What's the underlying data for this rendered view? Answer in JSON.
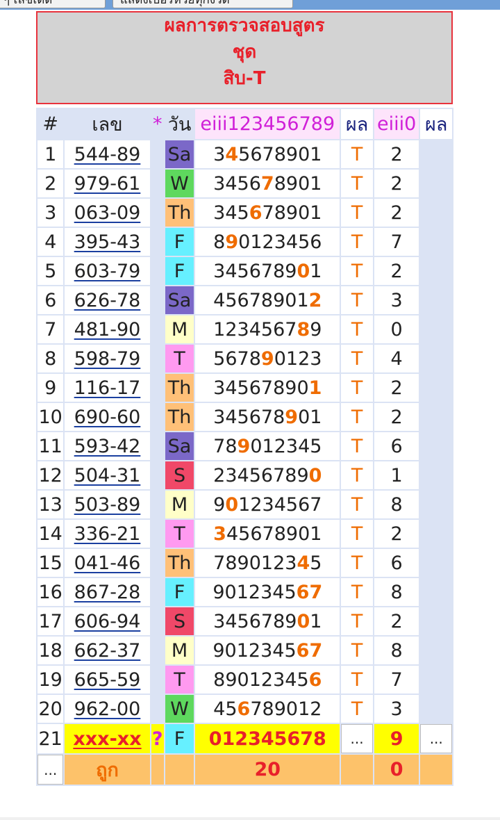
{
  "top_buttons": [
    "ๆ เลขเด็ด",
    "แสดงเบอร์หวยทุกงวด"
  ],
  "header": {
    "line1": "ผลการตรวจสอบสูตร",
    "line2": "ชุด",
    "line3": "สิบ-T"
  },
  "columns": {
    "index": "#",
    "number": "เลข",
    "star": "*",
    "day": "วัน",
    "digits": "eiii123456789",
    "result1": "ผล",
    "zero": "eiii0",
    "result2": "ผล"
  },
  "day_colors": {
    "Sa": "#7b68c8",
    "W": "#5ed85e",
    "Th": "#ffc078",
    "F": "#66f0ff",
    "M": "#ffffc8",
    "T": "#ff9af0",
    "S": "#f04868"
  },
  "rows": [
    {
      "no": "1",
      "num": "544-89",
      "day": "Sa",
      "seq": "345678901",
      "hi": 1,
      "res": "T",
      "z": "2"
    },
    {
      "no": "2",
      "num": "979-61",
      "day": "W",
      "seq": "3456789 01",
      "hi": 4,
      "res": "T",
      "z": "2"
    },
    {
      "no": "3",
      "num": "063-09",
      "day": "Th",
      "seq": "345678901",
      "hi": 3,
      "res": "T",
      "z": "2"
    },
    {
      "no": "4",
      "num": "395-43",
      "day": "F",
      "seq": "890123456",
      "hi": 1,
      "res": "T",
      "z": "7"
    },
    {
      "no": "5",
      "num": "603-79",
      "day": "F",
      "seq": "345678901",
      "hi": 7,
      "res": "T",
      "z": "2"
    },
    {
      "no": "6",
      "num": "626-78",
      "day": "Sa",
      "seq": "456789012",
      "hi": 8,
      "res": "T",
      "z": "3"
    },
    {
      "no": "7",
      "num": "481-90",
      "day": "M",
      "seq": "123456789",
      "hi": 7,
      "res": "T",
      "z": "0"
    },
    {
      "no": "8",
      "num": "598-79",
      "day": "T",
      "seq": "567890123",
      "hi": 4,
      "res": "T",
      "z": "4"
    },
    {
      "no": "9",
      "num": "116-17",
      "day": "Th",
      "seq": "345678901",
      "hi": 8,
      "res": "T",
      "z": "2"
    },
    {
      "no": "10",
      "num": "690-60",
      "day": "Th",
      "seq": "345678901",
      "hi": 6,
      "res": "T",
      "z": "2"
    },
    {
      "no": "11",
      "num": "593-42",
      "day": "Sa",
      "seq": "789012345",
      "hi": 2,
      "res": "T",
      "z": "6"
    },
    {
      "no": "12",
      "num": "504-31",
      "day": "S",
      "seq": "234567890",
      "hi": 8,
      "res": "T",
      "z": "1"
    },
    {
      "no": "13",
      "num": "503-89",
      "day": "M",
      "seq": "901234567",
      "hi": 1,
      "res": "T",
      "z": "8"
    },
    {
      "no": "14",
      "num": "336-21",
      "day": "T",
      "seq": "345678901",
      "hi": 0,
      "res": "T",
      "z": "2"
    },
    {
      "no": "15",
      "num": "041-46",
      "day": "Th",
      "seq": "789012345",
      "hi": 7,
      "res": "T",
      "z": "6"
    },
    {
      "no": "16",
      "num": "867-28",
      "day": "F",
      "seq": "901234567",
      "hi": [
        7,
        8
      ],
      "res": "T",
      "z": "8"
    },
    {
      "no": "17",
      "num": "606-94",
      "day": "S",
      "seq": "345678901",
      "hi": 7,
      "res": "T",
      "z": "2"
    },
    {
      "no": "18",
      "num": "662-37",
      "day": "M",
      "seq": "901234567",
      "hi": [
        7,
        8
      ],
      "res": "T",
      "z": "8"
    },
    {
      "no": "19",
      "num": "665-59",
      "day": "T",
      "seq": "890123456",
      "hi": 8,
      "res": "T",
      "z": "7"
    },
    {
      "no": "20",
      "num": "962-00",
      "day": "W",
      "seq": "456789012",
      "hi": 2,
      "res": "T",
      "z": "3"
    }
  ],
  "next_row": {
    "no": "21",
    "num": "xxx-xx",
    "star": "?",
    "day": "F",
    "seq": "012345678",
    "res": "...",
    "z": "9",
    "res2": "..."
  },
  "footer": {
    "dots": "...",
    "label": "ถูก",
    "hits": "20",
    "zero_hits": "0"
  }
}
